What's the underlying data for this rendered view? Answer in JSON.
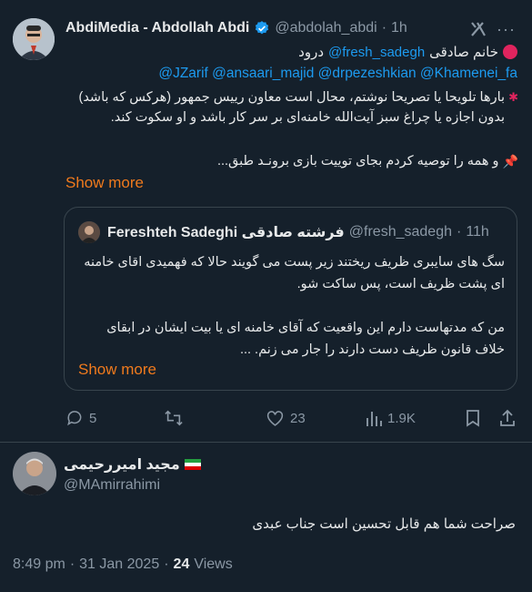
{
  "post": {
    "author_name": "AbdiMedia - Abdollah Abdi",
    "handle": "@abdolah_abdi",
    "time": "1h",
    "line1_prefix": "خانم صادقی",
    "line1_mention": "@fresh_sadegh",
    "line1_suffix": "درود",
    "mentions": "@JZarif @ansaari_majid @drpezeshkian @Khamenei_fa",
    "body1": "بارها تلویحا یا تصریحا نوشتم، محال است معاون رییس جمهور  (هرکس که باشد) بدون اجازه یا چراغ سبز آیت‌الله خامنه‌ای بر سر کار باشد و او سکوت کند.",
    "body2": "و همه را توصیه کردم بجای توییت بازی برونـد طبق...",
    "show_more": "Show more"
  },
  "quoted": {
    "name": "Fereshteh Sadeghi فرشته صادقی",
    "handle": "@fresh_sadegh",
    "time": "11h",
    "body1": "سگ های سایبری ظریف ریختند زیر پست می گویند حالا که فهمیدی اقای خامنه ای پشت ظریف است، پس ساکت شو.",
    "body2": "من که مدتهاست دارم این واقعیت که آقای خامنه ای یا بیت ایشان در ابقای خلاف قانون ظریف دست دارند را جار می زنم. ...",
    "show_more": "Show more"
  },
  "actions": {
    "replies": "5",
    "reposts": "",
    "likes": "23",
    "views": "1.9K"
  },
  "reply": {
    "name": "مجید امیررحیمی",
    "handle": "@MAmirrahimi",
    "body": "صراحت شما هم قابل تحسین است جناب عبدی"
  },
  "meta": {
    "time": "8:49 pm",
    "date": "31 Jan 2025",
    "views_count": "24",
    "views_label": "Views"
  }
}
